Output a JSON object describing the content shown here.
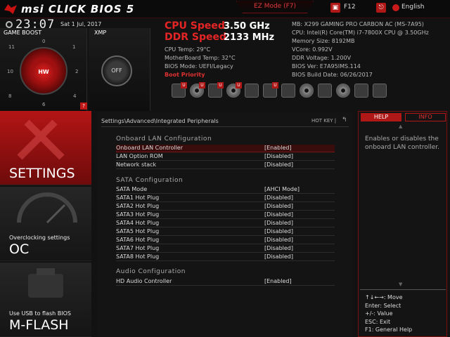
{
  "header": {
    "brand": "msi CLICK BIOS 5",
    "ez_mode": "EZ Mode (F7)",
    "f12": "F12",
    "language": "English",
    "time": "23:07",
    "date": "Sat  1 Jul, 2017"
  },
  "game_boost": {
    "title": "GAME BOOST",
    "center_label": "HW",
    "dial_numbers": [
      "11",
      "0",
      "1",
      "10",
      "2",
      "9",
      "3",
      "8",
      "4",
      "7",
      "6",
      "5"
    ]
  },
  "xmp": {
    "title": "XMP",
    "state": "OFF"
  },
  "system": {
    "cpu_speed_label": "CPU Speed",
    "cpu_speed_value": "3.50 GHz",
    "ddr_speed_label": "DDR Speed",
    "ddr_speed_value": "2133 MHz",
    "cpu_temp": "CPU Temp: 29°C",
    "mb_temp": "MotherBoard Temp: 32°C",
    "bios_mode": "BIOS Mode: UEFI/Legacy",
    "boot_priority": "Boot Priority",
    "mb": "MB: X299 GAMING PRO CARBON AC (MS-7A95)",
    "cpu": "CPU: Intel(R) Core(TM) i7-7800X CPU @ 3.50GHz",
    "memory": "Memory Size: 8192MB",
    "vcore": "VCore: 0.992V",
    "ddr_voltage": "DDR Voltage: 1.200V",
    "bios_ver": "BIOS Ver: E7A95IMS.114",
    "bios_date": "BIOS Build Date: 06/26/2017"
  },
  "boot_devices": [
    {
      "kind": "drive",
      "usb": true
    },
    {
      "kind": "disc",
      "usb": true
    },
    {
      "kind": "usb-drive",
      "usb": true
    },
    {
      "kind": "disc",
      "usb": true
    },
    {
      "kind": "usb",
      "usb": false
    },
    {
      "kind": "network",
      "usb": true
    },
    {
      "kind": "card",
      "usb": false
    },
    {
      "kind": "disc",
      "usb": false
    },
    {
      "kind": "usb",
      "usb": false
    },
    {
      "kind": "disc",
      "usb": false
    },
    {
      "kind": "usb",
      "usb": false
    },
    {
      "kind": "network",
      "usb": false
    }
  ],
  "nav": {
    "settings": "SETTINGS",
    "oc_sub": "Overclocking settings",
    "oc": "OC",
    "mflash_sub": "Use USB to flash BIOS",
    "mflash": "M-FLASH"
  },
  "main": {
    "breadcrumb": "Settings\\Advanced\\Integrated Peripherals",
    "hotkey": "HOT KEY  |",
    "back": "↰",
    "sections": [
      {
        "title": "Onboard LAN Configuration",
        "rows": [
          {
            "label": "Onboard LAN Controller",
            "value": "[Enabled]"
          },
          {
            "label": "LAN Option ROM",
            "value": "[Disabled]"
          },
          {
            "label": "Network stack",
            "value": "[Disabled]"
          }
        ]
      },
      {
        "title": "SATA Configuration",
        "rows": [
          {
            "label": "SATA Mode",
            "value": "[AHCI Mode]"
          },
          {
            "label": "SATA1 Hot Plug",
            "value": "[Disabled]"
          },
          {
            "label": "SATA2 Hot Plug",
            "value": "[Disabled]"
          },
          {
            "label": "SATA3 Hot Plug",
            "value": "[Disabled]"
          },
          {
            "label": "SATA4 Hot Plug",
            "value": "[Disabled]"
          },
          {
            "label": "SATA5 Hot Plug",
            "value": "[Disabled]"
          },
          {
            "label": "SATA6 Hot Plug",
            "value": "[Disabled]"
          },
          {
            "label": "SATA7 Hot Plug",
            "value": "[Disabled]"
          },
          {
            "label": "SATA8 Hot Plug",
            "value": "[Disabled]"
          }
        ]
      },
      {
        "title": "Audio Configuration",
        "rows": [
          {
            "label": "HD Audio Controller",
            "value": "[Enabled]"
          }
        ]
      }
    ]
  },
  "help": {
    "help_tab": "HELP",
    "info_tab": "INFO",
    "text": "Enables or disables the onboard LAN controller.",
    "keys": "↑↓←→: Move\nEnter: Select\n+/-: Value\nESC: Exit\nF1: General Help"
  },
  "colors": {
    "accent": "#c81212",
    "background": "#121212"
  }
}
